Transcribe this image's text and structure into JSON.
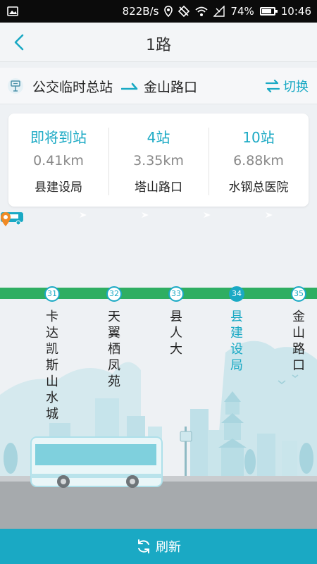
{
  "status_bar": {
    "speed": "822B/s",
    "battery_percent": "74%",
    "battery_level": 0.74,
    "time": "10:46"
  },
  "header": {
    "title": "1路"
  },
  "route": {
    "from": "公交临时总站",
    "to": "金山路口",
    "switch_label": "切换"
  },
  "info": [
    {
      "arrival": "即将到站",
      "distance": "0.41km",
      "station": "县建设局"
    },
    {
      "arrival": "4站",
      "distance": "3.35km",
      "station": "塔山路口"
    },
    {
      "arrival": "10站",
      "distance": "6.88km",
      "station": "水钢总医院"
    }
  ],
  "stops": [
    {
      "number": "31",
      "name": "卡达凯斯山水城",
      "current": false
    },
    {
      "number": "32",
      "name": "天翼栖凤苑",
      "current": false
    },
    {
      "number": "33",
      "name": "县人大",
      "current": false
    },
    {
      "number": "34",
      "name": "县建设局",
      "current": true
    },
    {
      "number": "35",
      "name": "金山路口",
      "current": false
    }
  ],
  "refresh": {
    "label": "刷新"
  },
  "colors": {
    "accent": "#1aa9c4",
    "track": "#2fae62",
    "pin": "#f08a24"
  },
  "icons": {
    "back": "chevron-left-icon",
    "bus_stop": "bus-stop-icon",
    "switch": "swap-arrows-icon",
    "refresh": "refresh-icon",
    "bus": "bus-icon",
    "location": "location-pin-icon"
  }
}
